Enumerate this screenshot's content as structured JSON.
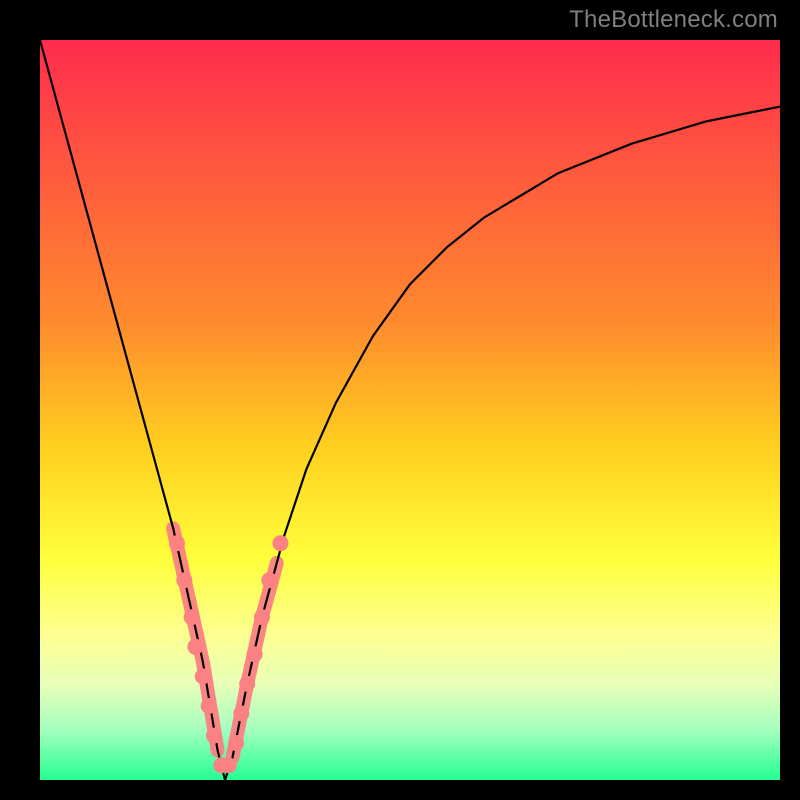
{
  "watermark": {
    "text": "TheBottleneck.com"
  },
  "colors": {
    "frame": "#000000",
    "curve": "#000000",
    "highlight": "#fb8183",
    "gradient_stops": [
      {
        "pos": 0.0,
        "color": "#ff2b4e"
      },
      {
        "pos": 0.18,
        "color": "#ff5a3d"
      },
      {
        "pos": 0.38,
        "color": "#ff8a2e"
      },
      {
        "pos": 0.55,
        "color": "#ffcf1f"
      },
      {
        "pos": 0.7,
        "color": "#ffff3a"
      },
      {
        "pos": 0.8,
        "color": "#fdff8e"
      },
      {
        "pos": 0.87,
        "color": "#e8ffb8"
      },
      {
        "pos": 0.93,
        "color": "#a7ffbf"
      },
      {
        "pos": 1.0,
        "color": "#25ff94"
      }
    ]
  },
  "chart_data": {
    "type": "line",
    "title": "",
    "xlabel": "",
    "ylabel": "",
    "xlim": [
      0,
      100
    ],
    "ylim": [
      0,
      100
    ],
    "notch_x": 25,
    "grid": false,
    "series": [
      {
        "name": "bottleneck-curve",
        "x": [
          0,
          3,
          6,
          9,
          12,
          15,
          18,
          20,
          22,
          23,
          24,
          25,
          26,
          27,
          28,
          30,
          33,
          36,
          40,
          45,
          50,
          55,
          60,
          65,
          70,
          75,
          80,
          85,
          90,
          95,
          100
        ],
        "y": [
          100,
          89,
          78,
          67,
          56,
          45,
          34,
          25,
          16,
          10,
          4,
          0,
          3,
          8,
          13,
          22,
          33,
          42,
          51,
          60,
          67,
          72,
          76,
          79,
          82,
          84,
          86,
          87.5,
          89,
          90,
          91
        ]
      }
    ],
    "highlight_ranges": [
      {
        "xmin": 18,
        "xmax": 24
      },
      {
        "xmin": 26,
        "xmax": 32
      }
    ],
    "highlight_dots": [
      {
        "x": 18.5,
        "y": 32
      },
      {
        "x": 19.5,
        "y": 27
      },
      {
        "x": 20.5,
        "y": 22
      },
      {
        "x": 21.0,
        "y": 18
      },
      {
        "x": 22.0,
        "y": 14
      },
      {
        "x": 22.8,
        "y": 10
      },
      {
        "x": 23.5,
        "y": 6
      },
      {
        "x": 24.5,
        "y": 2
      },
      {
        "x": 25.5,
        "y": 2
      },
      {
        "x": 26.5,
        "y": 5
      },
      {
        "x": 27.2,
        "y": 9
      },
      {
        "x": 28.0,
        "y": 13
      },
      {
        "x": 29.0,
        "y": 17
      },
      {
        "x": 30.0,
        "y": 22
      },
      {
        "x": 31.0,
        "y": 27
      },
      {
        "x": 32.5,
        "y": 32
      }
    ]
  }
}
